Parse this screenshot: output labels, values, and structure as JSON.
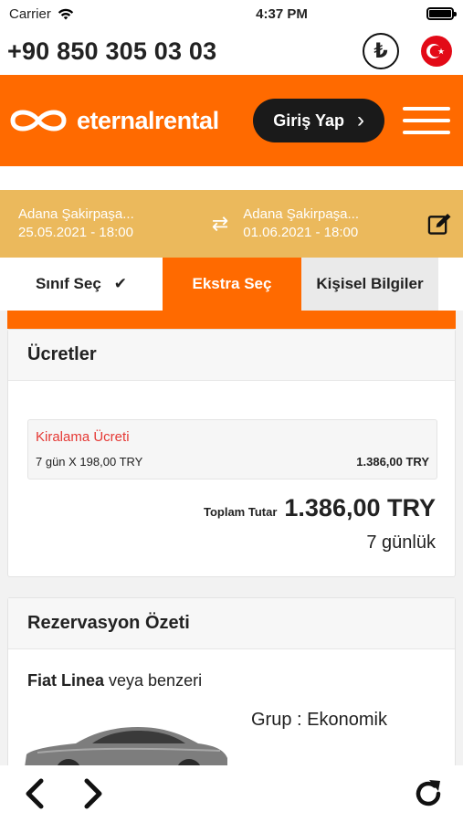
{
  "status_bar": {
    "carrier": "Carrier",
    "time": "4:37 PM"
  },
  "contact": {
    "phone": "+90 850 305 03 03",
    "currency_symbol": "₺"
  },
  "header": {
    "brand": "eternalrental",
    "login_label": "Giriş Yap",
    "login_chevron": "›"
  },
  "booking": {
    "pickup_location": "Adana Şakirpaşa...",
    "pickup_datetime": "25.05.2021 - 18:00",
    "dropoff_location": "Adana Şakirpaşa...",
    "dropoff_datetime": "01.06.2021 - 18:00",
    "swap_icon": "⇄"
  },
  "steps": {
    "step1": "Sınıf Seç",
    "step1_check": "✔",
    "step2": "Ekstra Seç",
    "step3": "Kişisel Bilgiler"
  },
  "fees": {
    "title": "Ücretler",
    "rental_fee_title": "Kiralama Ücreti",
    "rental_fee_calc": "7 gün X 198,00 TRY",
    "rental_fee_amount": "1.386,00 TRY",
    "total_label": "Toplam Tutar",
    "total_value": "1.386,00 TRY",
    "duration": "7 günlük"
  },
  "summary": {
    "title": "Rezervasyon Özeti",
    "car_model": "Fiat Linea",
    "car_suffix": " veya benzeri",
    "group": "Grup : Ekonomik"
  },
  "colors": {
    "brand_orange": "#ff6a00",
    "date_bar": "#ebb95c",
    "fee_title_red": "#e53935",
    "login_button": "#1a1a1a"
  },
  "icons": [
    "wifi-icon",
    "battery-icon",
    "lira-icon",
    "turkey-flag-icon",
    "infinity-logo-icon",
    "chevron-right-icon",
    "hamburger-icon",
    "swap-arrows-icon",
    "edit-icon",
    "check-icon",
    "back-arrow-icon",
    "forward-arrow-icon",
    "reload-icon"
  ]
}
